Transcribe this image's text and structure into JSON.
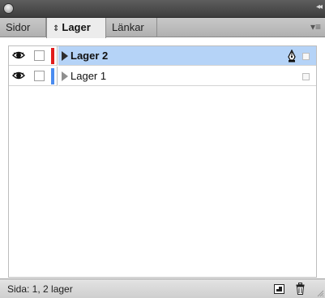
{
  "window": {
    "close_icon": "close-circle",
    "collapse_glyph": "◂◂"
  },
  "tabs": [
    {
      "label": "Sidor",
      "active": false
    },
    {
      "label": "Lager",
      "active": true,
      "arrow": "⇕"
    },
    {
      "label": "Länkar",
      "active": false
    }
  ],
  "panel_menu_glyph": "▾≡",
  "layers": [
    {
      "name": "Lager 2",
      "visible": true,
      "locked": false,
      "color": "#e21c1c",
      "selected": true,
      "pen_icon": "pen-icon"
    },
    {
      "name": "Lager 1",
      "visible": true,
      "locked": false,
      "color": "#4a8cf0",
      "selected": false
    }
  ],
  "status": {
    "text": "Sida: 1, 2 lager",
    "new_layer_icon": "new-layer-icon",
    "delete_icon": "trash-icon"
  }
}
